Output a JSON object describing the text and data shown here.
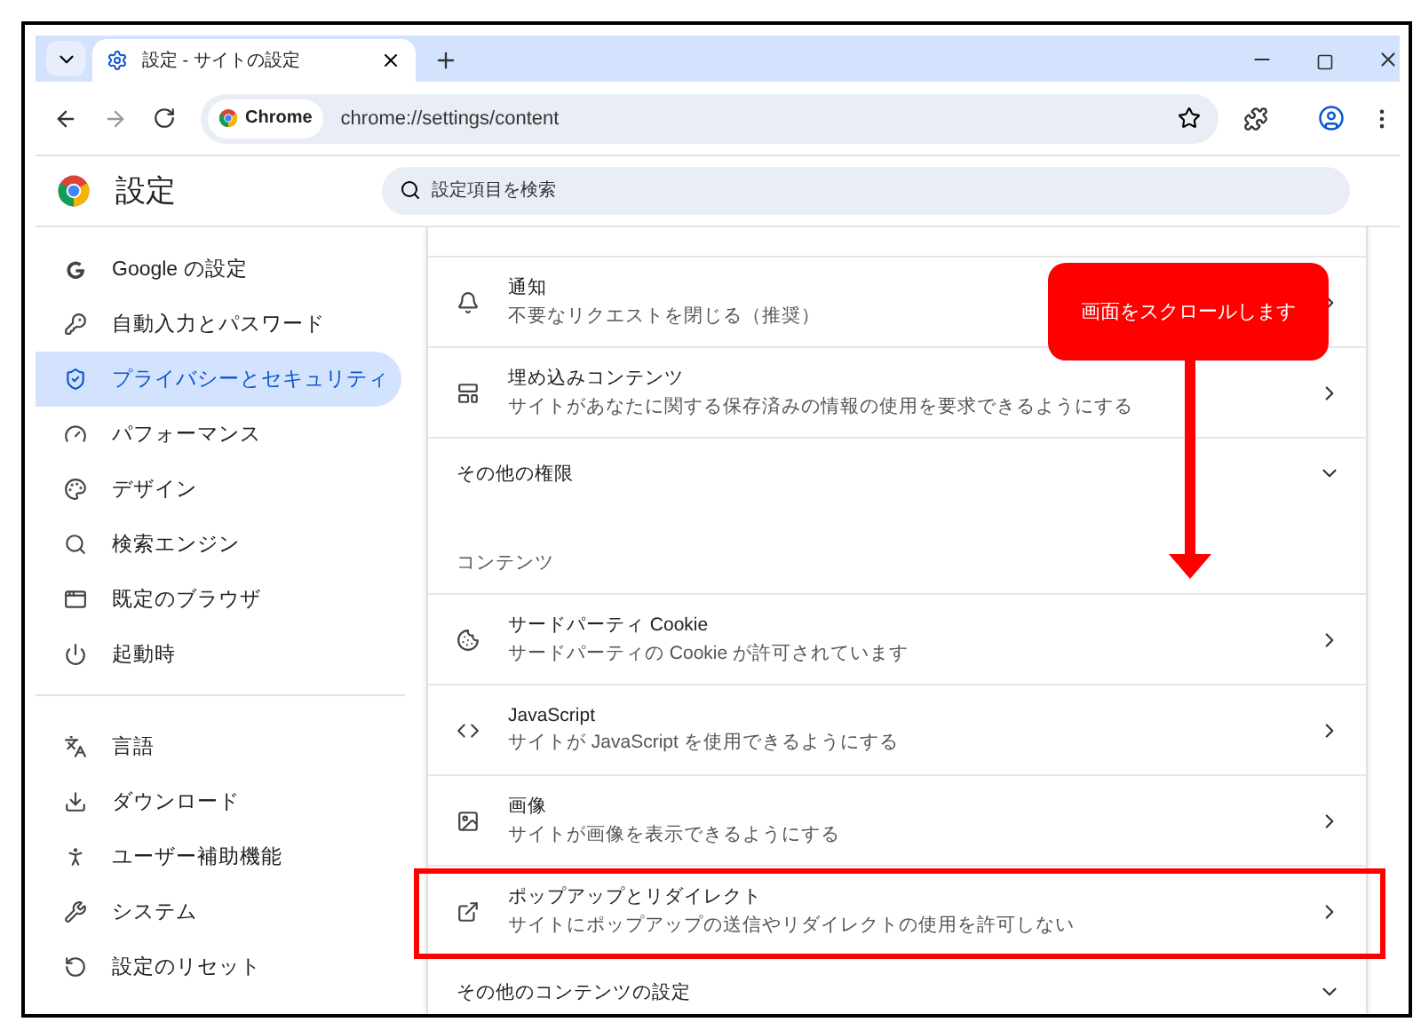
{
  "tab_strip": {
    "tab": {
      "title": "設定 - サイトの設定",
      "selected": true
    }
  },
  "toolbar": {
    "site_chip": "Chrome",
    "url": "chrome://settings/content"
  },
  "header": {
    "title": "設定",
    "search": {
      "placeholder": "設定項目を検索"
    }
  },
  "sidebar": {
    "groups": [
      [
        {
          "label": "Google の設定",
          "selected": false
        },
        {
          "label": "自動入力とパスワード",
          "selected": false
        },
        {
          "label": "プライバシーとセキュリティ",
          "selected": true
        },
        {
          "label": "パフォーマンス",
          "selected": false
        },
        {
          "label": "デザイン",
          "selected": false
        },
        {
          "label": "検索エンジン",
          "selected": false
        },
        {
          "label": "既定のブラウザ",
          "selected": false
        },
        {
          "label": "起動時",
          "selected": false
        }
      ],
      [
        {
          "label": "言語",
          "selected": false
        },
        {
          "label": "ダウンロード",
          "selected": false
        },
        {
          "label": "ユーザー補助機能",
          "selected": false
        },
        {
          "label": "システム",
          "selected": false
        },
        {
          "label": "設定のリセット",
          "selected": false
        }
      ]
    ]
  },
  "content": {
    "rows": [
      {
        "kind": "item",
        "title": "通知",
        "subtitle": "不要なリクエストを閉じる（推奨）",
        "highlighted": false
      },
      {
        "kind": "item",
        "title": "埋め込みコンテンツ",
        "subtitle": "サイトがあなたに関する保存済みの情報の使用を要求できるようにする",
        "highlighted": false
      },
      {
        "kind": "expander",
        "title": "その他の権限",
        "expanded": false
      },
      {
        "kind": "heading",
        "title": "コンテンツ"
      },
      {
        "kind": "item",
        "title": "サードパーティ Cookie",
        "subtitle": "サードパーティの Cookie が許可されています",
        "highlighted": false
      },
      {
        "kind": "item",
        "title": "JavaScript",
        "subtitle": "サイトが JavaScript を使用できるようにする",
        "highlighted": false
      },
      {
        "kind": "item",
        "title": "画像",
        "subtitle": "サイトが画像を表示できるようにする",
        "highlighted": false
      },
      {
        "kind": "item",
        "title": "ポップアップとリダイレクト",
        "subtitle": "サイトにポップアップの送信やリダイレクトの使用を許可しない",
        "highlighted": true
      },
      {
        "kind": "expander",
        "title": "その他のコンテンツの設定",
        "expanded": false
      }
    ]
  },
  "callout": {
    "text": "画面をスクロールします"
  }
}
